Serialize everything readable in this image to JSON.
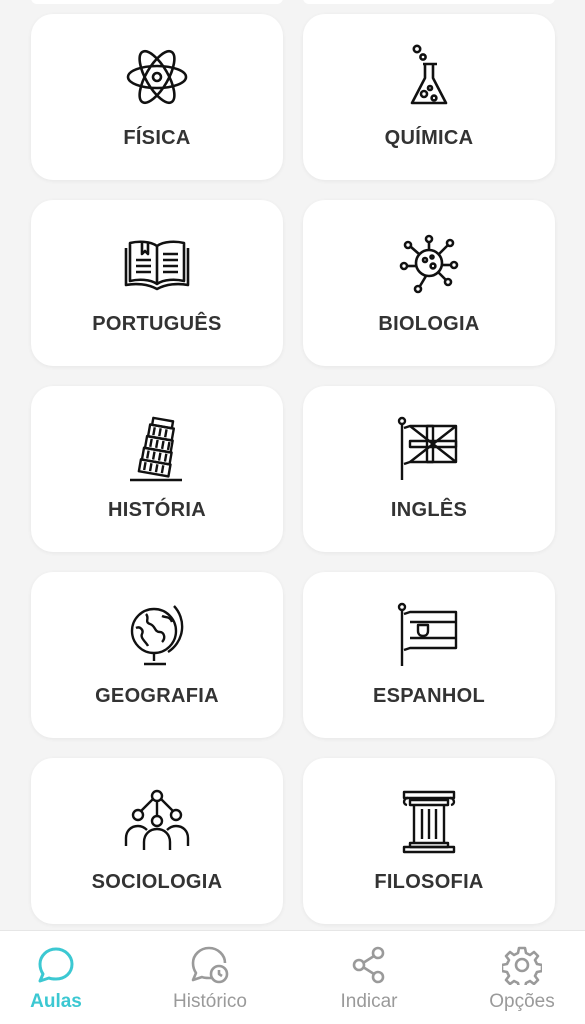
{
  "subjects": [
    {
      "label": "FÍSICA",
      "icon": "atom-icon"
    },
    {
      "label": "QUÍMICA",
      "icon": "flask-icon"
    },
    {
      "label": "PORTUGUÊS",
      "icon": "book-icon"
    },
    {
      "label": "BIOLOGIA",
      "icon": "virus-icon"
    },
    {
      "label": "HISTÓRIA",
      "icon": "pisa-tower-icon"
    },
    {
      "label": "INGLÊS",
      "icon": "uk-flag-icon"
    },
    {
      "label": "GEOGRAFIA",
      "icon": "globe-icon"
    },
    {
      "label": "ESPANHOL",
      "icon": "spain-flag-icon"
    },
    {
      "label": "SOCIOLOGIA",
      "icon": "people-network-icon"
    },
    {
      "label": "FILOSOFIA",
      "icon": "column-icon"
    }
  ],
  "bottom_nav": {
    "items": [
      {
        "label": "Aulas",
        "icon": "chat-bubble-icon",
        "active": true
      },
      {
        "label": "Histórico",
        "icon": "chat-clock-icon",
        "active": false
      },
      {
        "label": "Indicar",
        "icon": "share-icon",
        "active": false
      },
      {
        "label": "Opções",
        "icon": "gear-icon",
        "active": false
      }
    ]
  },
  "colors": {
    "accent": "#3cc8d2",
    "inactive": "#9a9a9a",
    "background": "#f4f4f4",
    "card": "#ffffff",
    "text": "#333333"
  }
}
